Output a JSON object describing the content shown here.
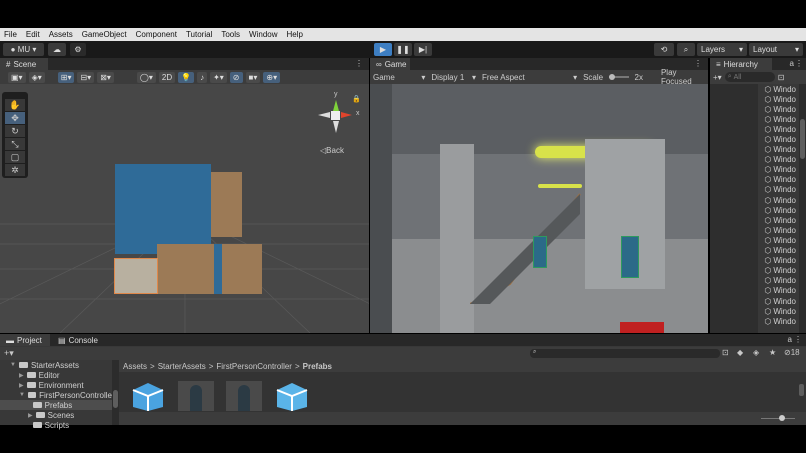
{
  "menu": [
    "File",
    "Edit",
    "Assets",
    "GameObject",
    "Component",
    "Tutorial",
    "Tools",
    "Window",
    "Help"
  ],
  "toolbar": {
    "account": "MU",
    "layers": "Layers",
    "layout": "Layout"
  },
  "scene": {
    "tab": "Scene",
    "btn_2d": "2D",
    "back": "Back",
    "axis_x": "x",
    "axis_y": "y"
  },
  "game": {
    "tab": "Game",
    "mode": "Game",
    "display": "Display 1",
    "aspect": "Free Aspect",
    "scale_label": "Scale",
    "scale_value": "2x",
    "play_focused": "Play Focused"
  },
  "hierarchy": {
    "tab": "Hierarchy",
    "search_placeholder": "All",
    "items": [
      "Windo",
      "Windo",
      "Windo",
      "Windo",
      "Windo",
      "Windo",
      "Windo",
      "Windo",
      "Windo",
      "Windo",
      "Windo",
      "Windo",
      "Windo",
      "Windo",
      "Windo",
      "Windo",
      "Windo",
      "Windo",
      "Windo",
      "Windo",
      "Windo",
      "Windo",
      "Windo",
      "Windo"
    ]
  },
  "project": {
    "tab_project": "Project",
    "tab_console": "Console",
    "tree": [
      {
        "label": "StarterAssets",
        "depth": 0,
        "open": true
      },
      {
        "label": "Editor",
        "depth": 1
      },
      {
        "label": "Environment",
        "depth": 1
      },
      {
        "label": "FirstPersonControlle",
        "depth": 1,
        "open": true
      },
      {
        "label": "Prefabs",
        "depth": 2,
        "selected": true
      },
      {
        "label": "Scenes",
        "depth": 2
      },
      {
        "label": "Scripts",
        "depth": 2
      }
    ],
    "breadcrumb": [
      "Assets",
      "StarterAssets",
      "FirstPersonController",
      "Prefabs"
    ],
    "hidden_count": "18"
  },
  "colors": {
    "accent": "#46607c",
    "play": "#3d7ec2"
  }
}
